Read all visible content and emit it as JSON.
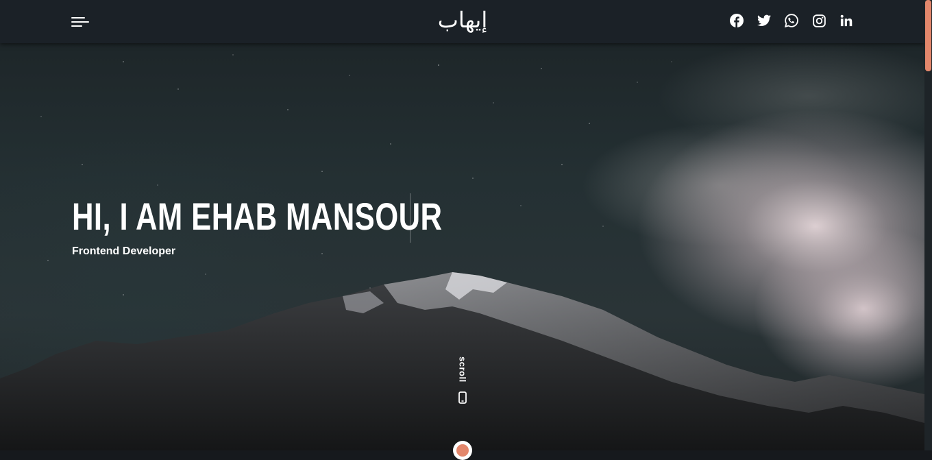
{
  "header": {
    "logo_text": "إيهاب",
    "menu_icon": "hamburger-menu-icon",
    "socials": [
      {
        "name": "facebook",
        "icon": "facebook-icon"
      },
      {
        "name": "twitter",
        "icon": "twitter-icon"
      },
      {
        "name": "whatsapp",
        "icon": "whatsapp-icon"
      },
      {
        "name": "instagram",
        "icon": "instagram-icon"
      },
      {
        "name": "linkedin",
        "icon": "linkedin-icon"
      }
    ]
  },
  "hero": {
    "headline": "HI, I AM EHAB MANSOUR",
    "subtitle": "Frontend Developer",
    "scroll_label": "scroll",
    "scroll_icon": "phone-icon"
  },
  "colors": {
    "accent": "#e3876c",
    "navbar": "#1b2127",
    "text": "#ffffff"
  }
}
